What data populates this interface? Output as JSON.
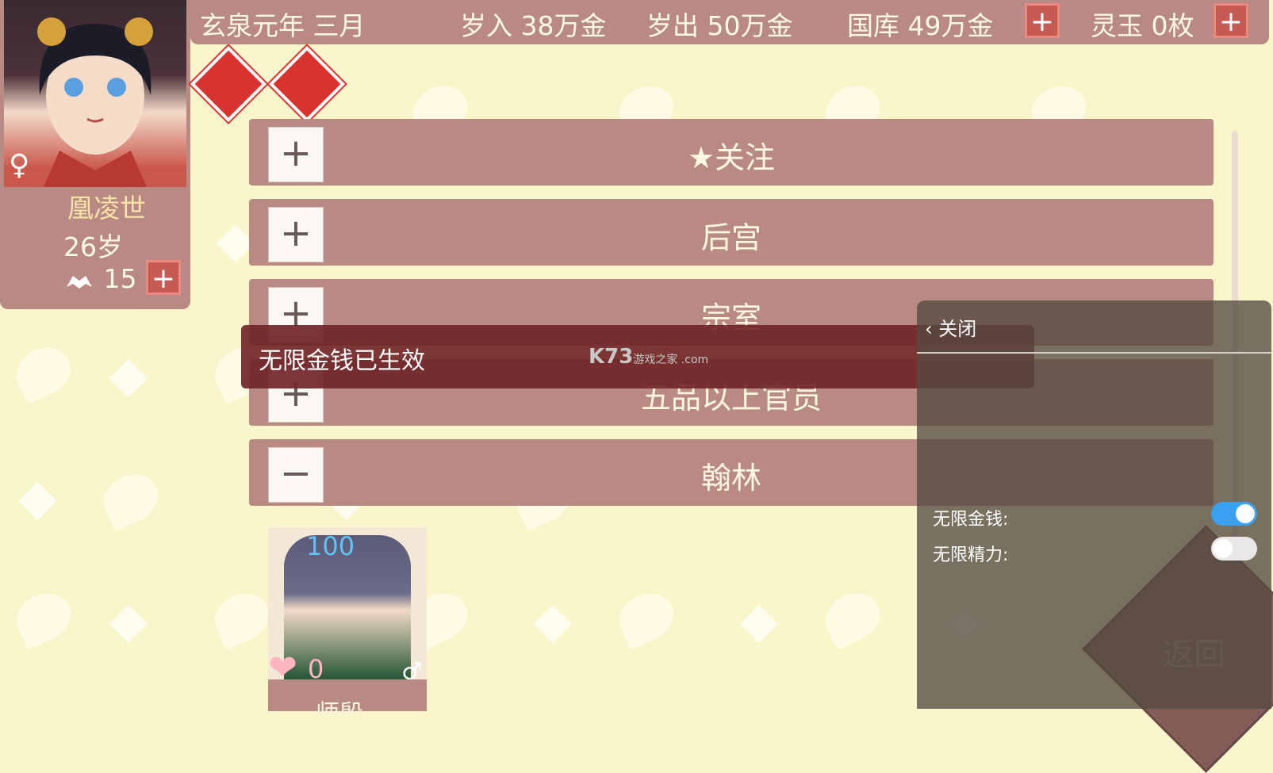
{
  "header": {
    "date": "玄泉元年 三月",
    "income": "岁入 38万金",
    "expense": "岁出 50万金",
    "treasury": "国库 49万金",
    "jade": "灵玉 0枚",
    "plus_label": "+"
  },
  "character": {
    "name": "凰凌世",
    "age": "26岁",
    "power": "15",
    "gender_symbol": "♀",
    "plus_label": "+"
  },
  "top_icons": [
    "throne-icon",
    "coins-icon"
  ],
  "list": {
    "rows": [
      {
        "toggle": "+",
        "label": "★关注"
      },
      {
        "toggle": "+",
        "label": "后宫"
      },
      {
        "toggle": "+",
        "label": "宗室"
      },
      {
        "toggle": "+",
        "label": "五品以上官员"
      },
      {
        "toggle": "−",
        "label": "翰林"
      }
    ]
  },
  "toast": {
    "message": "无限金钱已生效",
    "watermark_main": "K73",
    "watermark_sub": "游戏之家",
    "watermark_domain": ".com"
  },
  "cheat_panel": {
    "close_label": "关闭",
    "back_glyph": "‹",
    "options": [
      {
        "label": "无限金钱:",
        "enabled": true
      },
      {
        "label": "无限精力:",
        "enabled": false
      }
    ],
    "return_label": "返回"
  },
  "sub_character": {
    "favor": "100",
    "affection": "0",
    "gender_symbol": "♂",
    "name": "师殷"
  },
  "colors": {
    "bar": "#b98a84",
    "toast": "#702528",
    "switch_on": "#3aa0f0",
    "switch_off": "#e8e8e8"
  }
}
